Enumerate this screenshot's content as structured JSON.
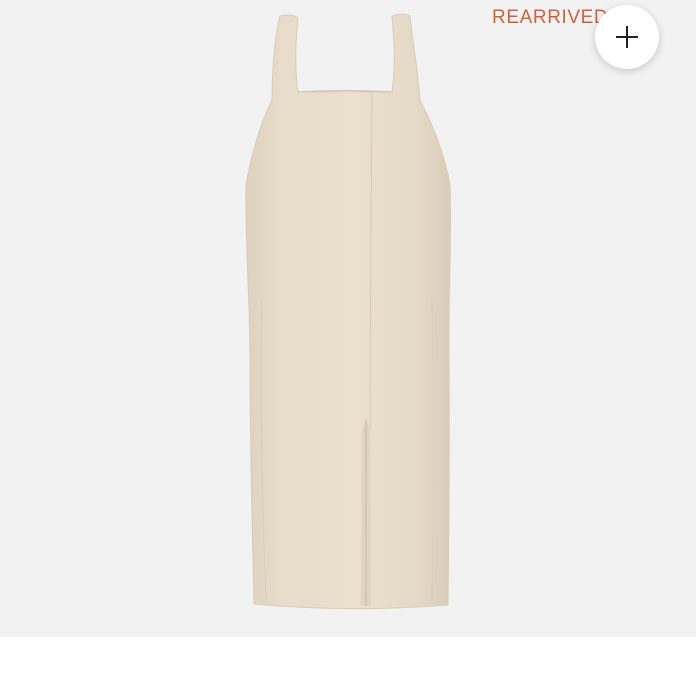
{
  "product": {
    "badge_text": "REARRIVED",
    "add_button_icon": "plus-icon",
    "image_subject": "dress-image",
    "colors": {
      "image_background": "#f2f2f2",
      "badge": "#d4603a",
      "dress": "#e7dcc8"
    }
  }
}
